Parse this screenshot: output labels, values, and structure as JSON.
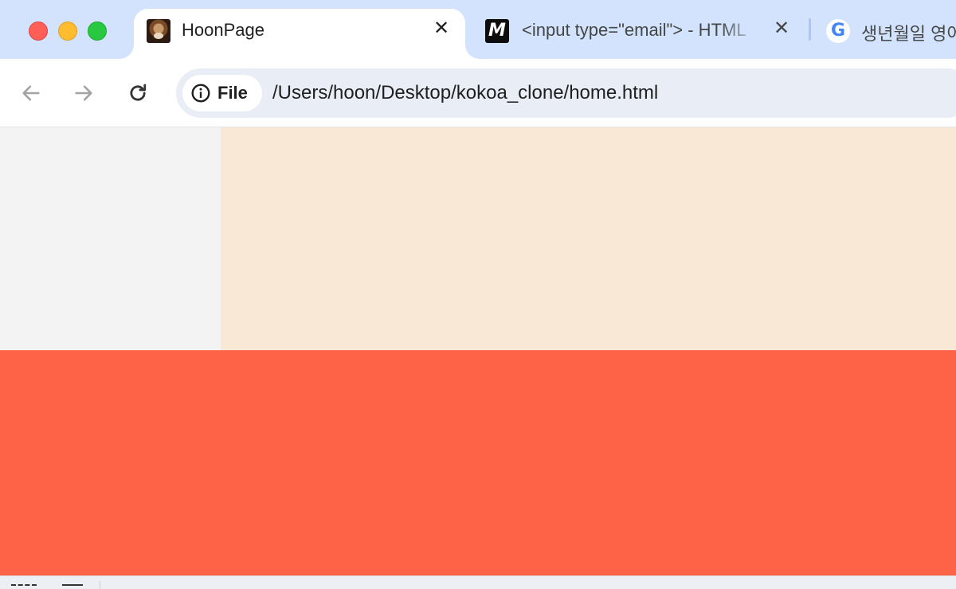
{
  "window": {
    "controls": [
      "close",
      "minimize",
      "maximize"
    ]
  },
  "tabs": [
    {
      "title": "HoonPage",
      "favicon": "dog-photo-favicon",
      "active": true,
      "close_label": "✕"
    },
    {
      "title": "<input type=\"email\"> - HTML",
      "favicon": "mdn-logo-favicon",
      "active": false,
      "close_label": "✕"
    },
    {
      "title": "생년월일 영어",
      "favicon": "google-logo-favicon",
      "active": false
    }
  ],
  "toolbar": {
    "back_icon": "arrow-left-icon",
    "forward_icon": "arrow-right-icon",
    "reload_icon": "reload-icon"
  },
  "omnibox": {
    "security_chip_label": "File",
    "security_icon": "info-circle-icon",
    "url": "/Users/hoon/Desktop/kokoa_clone/home.html"
  },
  "page": {
    "colors": {
      "sidebar": "#f3f3f3",
      "hero": "#fae8d6",
      "band": "#ff6347"
    }
  },
  "favicons": {
    "mdn_glyph": "M",
    "google_glyph": "G"
  }
}
